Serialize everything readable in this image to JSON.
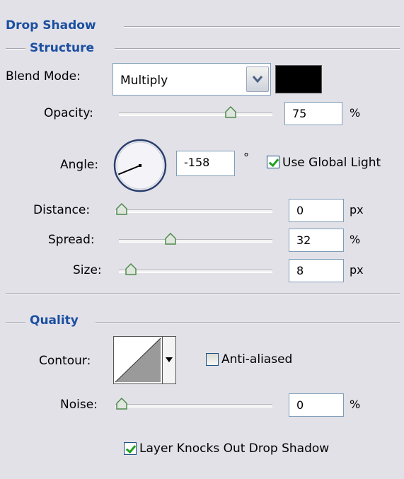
{
  "panel": {
    "title": "Drop Shadow"
  },
  "structure": {
    "title": "Structure",
    "blend_mode": {
      "label": "Blend Mode:",
      "value": "Multiply",
      "color": "#000000"
    },
    "opacity": {
      "label": "Opacity:",
      "value": "75",
      "unit": "%",
      "level": 0.75
    },
    "angle": {
      "label": "Angle:",
      "value": "-158",
      "unit": "°",
      "degrees": -158
    },
    "use_global_light": {
      "label": "Use Global Light",
      "checked": true
    },
    "distance": {
      "label": "Distance:",
      "value": "0",
      "unit": "px",
      "level": 0.0
    },
    "spread": {
      "label": "Spread:",
      "value": "32",
      "unit": "%",
      "level": 0.32
    },
    "size": {
      "label": "Size:",
      "value": "8",
      "unit": "px",
      "level": 0.04
    }
  },
  "quality": {
    "title": "Quality",
    "contour": {
      "label": "Contour:"
    },
    "anti_aliased": {
      "label": "Anti-aliased",
      "checked": false
    },
    "noise": {
      "label": "Noise:",
      "value": "0",
      "unit": "%",
      "level": 0.0
    }
  },
  "layer_knocks_out": {
    "label": "Layer Knocks Out Drop Shadow",
    "checked": true
  },
  "colors": {
    "background": "#e2e1e8",
    "title_blue": "#1b4fa0",
    "check_green": "#21a121"
  }
}
